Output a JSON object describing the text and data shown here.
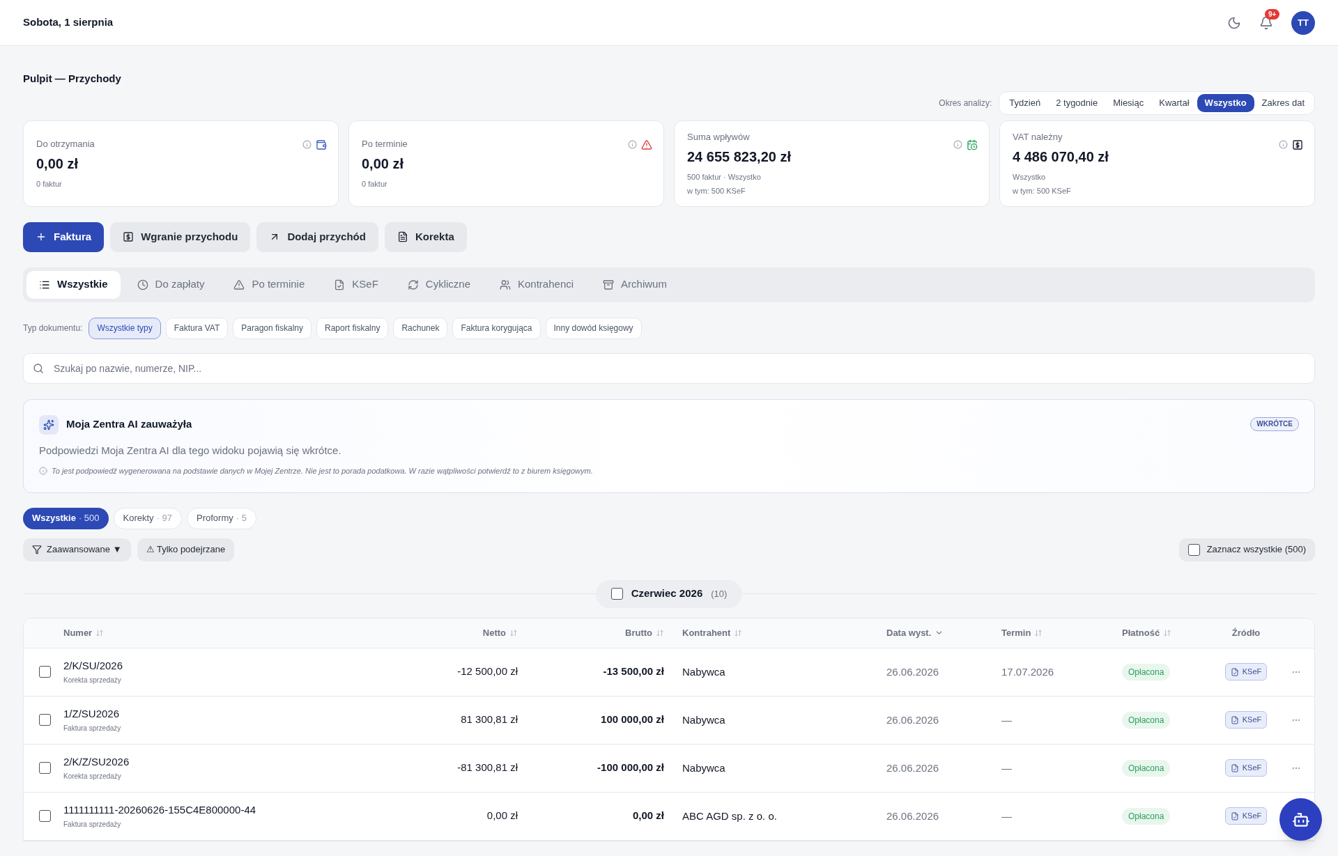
{
  "header": {
    "date": "Sobota, 1 sierpnia",
    "notifications_badge": "9+",
    "avatar": "TT"
  },
  "page_title": "Pulpit — Przychody",
  "period": {
    "label": "Okres analizy:",
    "options": [
      {
        "label": "Tydzień",
        "selected": false
      },
      {
        "label": "2 tygodnie",
        "selected": false
      },
      {
        "label": "Miesiąc",
        "selected": false
      },
      {
        "label": "Kwartał",
        "selected": false
      },
      {
        "label": "Wszystko",
        "selected": true
      },
      {
        "label": "Zakres dat",
        "selected": false
      }
    ]
  },
  "cards": [
    {
      "label": "Do otrzymania",
      "value": "0,00 zł",
      "lines": [
        "0 faktur"
      ],
      "kind": "wallet"
    },
    {
      "label": "Po terminie",
      "value": "0,00 zł",
      "lines": [
        "0 faktur"
      ],
      "kind": "alert"
    },
    {
      "label": "Suma wpływów",
      "value": "24 655 823,20 zł",
      "lines": [
        "500 faktur · Wszystko",
        "w tym: 500 KSeF"
      ],
      "kind": "calendar"
    },
    {
      "label": "VAT należny",
      "value": "4 486 070,40 zł",
      "lines": [
        "Wszystko",
        "w tym: 500 KSeF"
      ],
      "kind": "dollar"
    }
  ],
  "actions": [
    {
      "label": "Faktura",
      "kind": "primary"
    },
    {
      "label": "Wgranie przychodu",
      "kind": "secondary"
    },
    {
      "label": "Dodaj przychód",
      "kind": "secondary"
    },
    {
      "label": "Korekta",
      "kind": "secondary"
    }
  ],
  "tabs": [
    {
      "label": "Wszystkie",
      "selected": true
    },
    {
      "label": "Do zapłaty",
      "selected": false
    },
    {
      "label": "Po terminie",
      "selected": false
    },
    {
      "label": "KSeF",
      "selected": false
    },
    {
      "label": "Cykliczne",
      "selected": false
    },
    {
      "label": "Kontrahenci",
      "selected": false
    },
    {
      "label": "Archiwum",
      "selected": false
    }
  ],
  "doc_types": {
    "label": "Typ dokumentu:",
    "options": [
      {
        "label": "Wszystkie typy",
        "selected": true
      },
      {
        "label": "Faktura VAT",
        "selected": false
      },
      {
        "label": "Paragon fiskalny",
        "selected": false
      },
      {
        "label": "Raport fiskalny",
        "selected": false
      },
      {
        "label": "Rachunek",
        "selected": false
      },
      {
        "label": "Faktura korygująca",
        "selected": false
      },
      {
        "label": "Inny dowód księgowy",
        "selected": false
      }
    ]
  },
  "search": {
    "placeholder": "Szukaj po nazwie, numerze, NIP..."
  },
  "ai_panel": {
    "title": "Moja Zentra AI zauważyła",
    "badge": "WKRÓTCE",
    "message": "Podpowiedzi Moja Zentra AI dla tego widoku pojawią się wkrótce.",
    "disclaimer": "To jest podpowiedź wygenerowana na podstawie danych w Mojej Zentrze. Nie jest to porada podatkowa. W razie wątpliwości potwierdź to z biurem księgowym."
  },
  "status_chips": [
    {
      "label": "Wszystkie",
      "count": "· 500",
      "selected": true
    },
    {
      "label": "Korekty",
      "count": "· 97",
      "selected": false
    },
    {
      "label": "Proformy",
      "count": "· 5",
      "selected": false
    }
  ],
  "filters": [
    {
      "label": "Zaawansowane ▼",
      "kind": "filter"
    },
    {
      "label": "⚠ Tylko podejrzane",
      "kind": "plain"
    }
  ],
  "select_all": {
    "label": "Zaznacz wszystkie (500)",
    "checked": false
  },
  "group": {
    "label": "Czerwiec 2026",
    "count": "(10)",
    "checked": false
  },
  "table": {
    "columns": [
      {
        "label": "Numer",
        "kind": "sortable"
      },
      {
        "label": "Netto",
        "kind": "sortable"
      },
      {
        "label": "Brutto",
        "kind": "sortable"
      },
      {
        "label": "Kontrahent",
        "kind": "sortable"
      },
      {
        "label": "Data wyst.",
        "kind": "sorted"
      },
      {
        "label": "Termin",
        "kind": "sortable"
      },
      {
        "label": "Płatność",
        "kind": "sortable"
      },
      {
        "label": "Źródło",
        "kind": "plain"
      }
    ],
    "rows": [
      {
        "checked": false,
        "number": "2/K/SU/2026",
        "type": "Korekta sprzedaży",
        "netto": "-12 500,00 zł",
        "brutto": "-13 500,00 zł",
        "contractor": "Nabywca",
        "issue_date": "26.06.2026",
        "due_date": "17.07.2026",
        "payment": "Opłacona",
        "source": "KSeF"
      },
      {
        "checked": false,
        "number": "1/Z/SU2026",
        "type": "Faktura sprzedaży",
        "netto": "81 300,81 zł",
        "brutto": "100 000,00 zł",
        "contractor": "Nabywca",
        "issue_date": "26.06.2026",
        "due_date": "—",
        "payment": "Opłacona",
        "source": "KSeF"
      },
      {
        "checked": false,
        "number": "2/K/Z/SU2026",
        "type": "Korekta sprzedaży",
        "netto": "-81 300,81 zł",
        "brutto": "-100 000,00 zł",
        "contractor": "Nabywca",
        "issue_date": "26.06.2026",
        "due_date": "—",
        "payment": "Opłacona",
        "source": "KSeF"
      },
      {
        "checked": false,
        "number": "1111111111-20260626-155C4E800000-44",
        "type": "Faktura sprzedaży",
        "netto": "0,00 zł",
        "brutto": "0,00 zł",
        "contractor": "ABC AGD sp. z o. o.",
        "issue_date": "26.06.2026",
        "due_date": "—",
        "payment": "Opłacona",
        "source": "KSeF"
      }
    ]
  }
}
